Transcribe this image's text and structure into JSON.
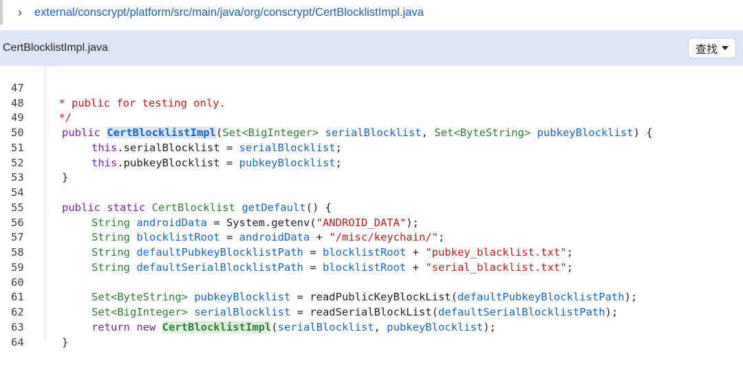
{
  "breadcrumb": {
    "path": "external/conscrypt/platform/src/main/java/org/conscrypt/CertBlocklistImpl.java"
  },
  "file_header": {
    "filename": "CertBlocklistImpl.java",
    "find_label": "查找"
  },
  "code": {
    "line_numbers": [
      "47",
      "48",
      "49",
      "50",
      "51",
      "52",
      "53",
      "54",
      "55",
      "56",
      "57",
      "58",
      "59",
      "60",
      "61",
      "62",
      "63",
      "64"
    ],
    "l47": " * public for testing only.",
    "l48": " */",
    "l49": {
      "kw": "public ",
      "cls": "CertBlocklistImpl",
      "p1": "(",
      "t1": "Set<BigInteger>",
      "sp1": " ",
      "v1": "serialBlocklist",
      "sep": ", ",
      "t2": "Set<ByteString>",
      "sp2": " ",
      "v2": "pubkeyBlocklist",
      "tail": ") {"
    },
    "l50": {
      "kw": "this",
      "mid": ".serialBlocklist = ",
      "v": "serialBlocklist",
      "end": ";"
    },
    "l51": {
      "kw": "this",
      "mid": ".pubkeyBlocklist = ",
      "v": "pubkeyBlocklist",
      "end": ";"
    },
    "l52": "}",
    "l54": {
      "kw": "public static ",
      "ty": "CertBlocklist",
      "sp": " ",
      "fn": "getDefault",
      "end": "() {"
    },
    "l55": {
      "ty": "String",
      "sp": " ",
      "v": "androidData",
      "mid": " = System.getenv(",
      "str": "\"ANDROID_DATA\"",
      "end": ");"
    },
    "l56": {
      "ty": "String",
      "sp": " ",
      "v": "blocklistRoot",
      "mid": " = ",
      "v2": "androidData",
      "plus": " + ",
      "str": "\"/misc/keychain/\"",
      "end": ";"
    },
    "l57": {
      "ty": "String",
      "sp": " ",
      "v": "defaultPubkeyBlocklistPath",
      "mid": " = ",
      "v2": "blocklistRoot",
      "plus": " + ",
      "str": "\"pubkey_blacklist.txt\"",
      "end": ";"
    },
    "l58": {
      "ty": "String",
      "sp": " ",
      "v": "defaultSerialBlocklistPath",
      "mid": " = ",
      "v2": "blocklistRoot",
      "plus": " + ",
      "str": "\"serial_blacklist.txt\"",
      "end": ";"
    },
    "l60": {
      "ty": "Set<ByteString>",
      "sp": " ",
      "v": "pubkeyBlocklist",
      "mid": " = readPublicKeyBlockList(",
      "v2": "defaultPubkeyBlocklistPath",
      "end": ");"
    },
    "l61": {
      "ty": "Set<BigInteger>",
      "sp": " ",
      "v": "serialBlocklist",
      "mid": " = readSerialBlockList(",
      "v2": "defaultSerialBlocklistPath",
      "end": ");"
    },
    "l62": {
      "kw": "return new ",
      "cls": "CertBlocklistImpl",
      "p1": "(",
      "v1": "serialBlocklist",
      "sep": ", ",
      "v2": "pubkeyBlocklist",
      "end": ");"
    },
    "l63": "}"
  },
  "colors": {
    "header_bg": "#dfe6f6",
    "link": "#1a5fb4",
    "keyword": "#7b1fa2",
    "type": "#2e7d32",
    "identifier": "#1565c0",
    "string": "#b71c1c"
  }
}
